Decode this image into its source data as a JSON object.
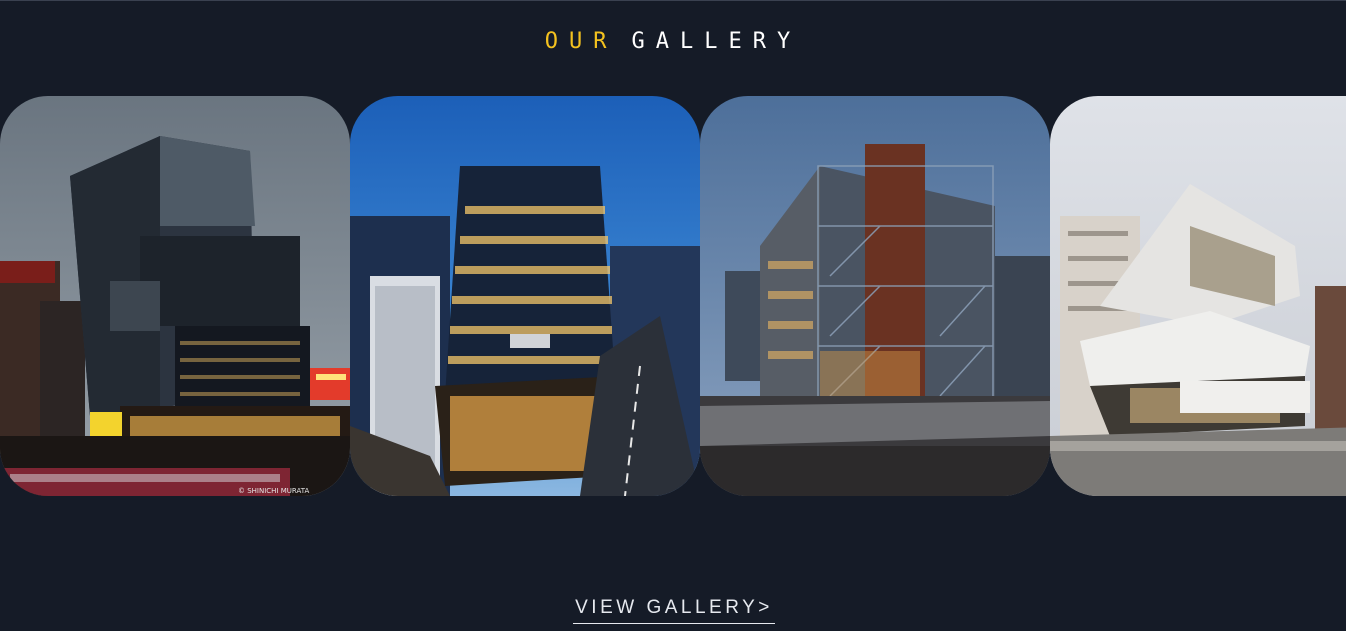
{
  "section": {
    "title_accent": "OUR",
    "title_main": "GALLERY"
  },
  "gallery": {
    "items": [
      {
        "name": "gallery-photo-1",
        "watermark": "© SHINICHI MURATA"
      },
      {
        "name": "gallery-photo-2"
      },
      {
        "name": "gallery-photo-3"
      },
      {
        "name": "gallery-photo-4"
      }
    ]
  },
  "cta": {
    "label": "VIEW GALLERY>"
  }
}
